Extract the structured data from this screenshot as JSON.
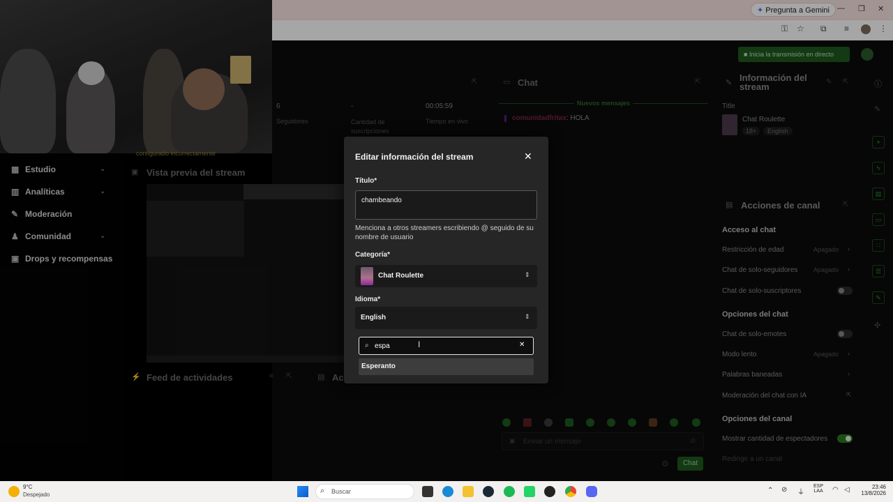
{
  "browser": {
    "gemini_label": "Pregunta a Gemini",
    "win_min": "—",
    "win_max": "❐",
    "win_close": "✕"
  },
  "header": {
    "go_live_label": "Inicia la transmisión en directo"
  },
  "warning_text": "configurado incorrectamente",
  "nav": {
    "items": [
      {
        "label": "Estudio",
        "icon": "grid-icon",
        "chevron": true
      },
      {
        "label": "Analíticas",
        "icon": "chart-icon",
        "chevron": true
      },
      {
        "label": "Moderación",
        "icon": "sword-icon",
        "chevron": false
      },
      {
        "label": "Comunidad",
        "icon": "people-icon",
        "chevron": true
      },
      {
        "label": "Drops y recompensas",
        "icon": "gift-icon",
        "chevron": false
      }
    ]
  },
  "stats": {
    "followers_value": "6",
    "followers_label": "Seguidores",
    "subs_value": "-",
    "subs_label": "Cantidad de suscripciones",
    "live_value": "00:05:59",
    "live_label": "Tiempo en vivo"
  },
  "preview": {
    "title": "Vista previa del stream"
  },
  "activity": {
    "title": "Feed de actividades",
    "title2": "Ac"
  },
  "chat": {
    "title": "Chat",
    "new_messages": "Nuevos mensajes",
    "message_user": "comunidadfritax",
    "message_text": ": HOLA",
    "input_placeholder": "Enviar un mensaje",
    "send_label": "Chat"
  },
  "stream_info": {
    "title": "Información del stream",
    "title_label": "Title",
    "stream_title": "Chat Roulette",
    "tag1": "18+",
    "tag2": "English"
  },
  "channel_actions": {
    "title": "Acciones de canal",
    "chat_access": "Acceso al chat",
    "age_restriction": "Restricción de edad",
    "age_status": "Apagado",
    "followers_only": "Chat de solo-seguidores",
    "followers_status": "Apagado",
    "subs_only": "Chat de solo-suscriptores",
    "chat_options": "Opciones del chat",
    "emotes_only": "Chat de solo-emotes",
    "slow_mode": "Modo lento",
    "slow_status": "Apagado",
    "banned_words": "Palabras baneadas",
    "ai_moderation": "Moderación del chat con IA",
    "channel_options": "Opciones del canal",
    "show_viewers": "Mostrar cantidad de espectadores",
    "raid": "Redirigir a un canal"
  },
  "modal": {
    "title": "Editar información del stream",
    "title_label": "Título*",
    "title_value": "chambeando",
    "mention_hint": "Menciona a otros streamers escribiendo @ seguido de su nombre de usuario",
    "category_label": "Categoría*",
    "category_value": "Chat Roulette",
    "language_label": "Idioma*",
    "language_value": "English",
    "search_value": "espa",
    "option": "Esperanto"
  },
  "taskbar": {
    "temp": "9°C",
    "weather": "Despejado",
    "search_placeholder": "Buscar",
    "lang1": "ESP",
    "lang2": "LAA",
    "time": "23:46",
    "date": "13/8/2026"
  },
  "colors": {
    "accent_green": "#2d8a2d",
    "modal_bg": "#262626",
    "chat_user": "#b0335c"
  }
}
